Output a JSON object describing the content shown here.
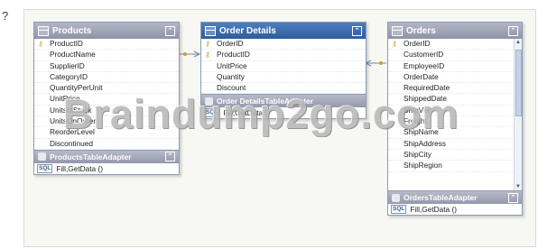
{
  "question_mark": "?",
  "products": {
    "title": "Products",
    "key_icon": "key-icon",
    "fields": [
      "ProductID",
      "ProductName",
      "SupplierID",
      "CategoryID",
      "QuantityPerUnit",
      "UnitPrice",
      "UnitsInStock",
      "UnitsOnOrder",
      "ReorderLevel",
      "Discontinued"
    ],
    "adapter": {
      "title": "ProductsTableAdapter",
      "method": "Fill,GetData ()"
    }
  },
  "order_details": {
    "title": "Order Details",
    "fields": [
      "OrderID",
      "ProductID",
      "UnitPrice",
      "Quantity",
      "Discount"
    ],
    "adapter": {
      "title": "Order DetailsTableAdapter",
      "method": "Fill,GetData ()"
    }
  },
  "orders": {
    "title": "Orders",
    "fields": [
      "OrderID",
      "CustomerID",
      "EmployeeID",
      "OrderDate",
      "RequiredDate",
      "ShippedDate",
      "ShipVia",
      "Freight",
      "ShipName",
      "ShipAddress",
      "ShipCity",
      "ShipRegion"
    ],
    "adapter": {
      "title": "OrdersTableAdapter",
      "method": "Fill,GetData ()"
    }
  },
  "watermark": "Braindump2go.com",
  "colors": {
    "header_gray": "#9a9db0",
    "header_blue": "#3a6aa8",
    "key": "#c9a12c"
  }
}
